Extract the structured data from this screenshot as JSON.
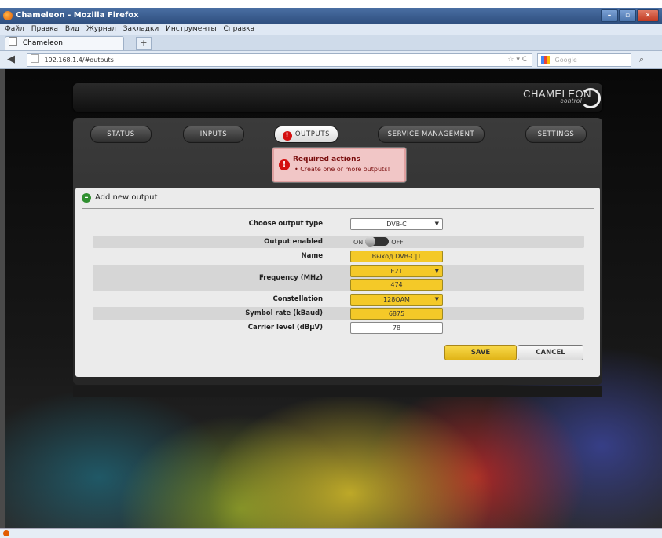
{
  "browser": {
    "window_title": "Chameleon - Mozilla Firefox",
    "menu": [
      "Файл",
      "Правка",
      "Вид",
      "Журнал",
      "Закладки",
      "Инструменты",
      "Справка"
    ],
    "tab_label": "Chameleon",
    "new_tab": "+",
    "url": "192.168.1.4/#outputs",
    "search_placeholder": "Google"
  },
  "header": {
    "logo": "CHAMELEON",
    "logo_sub": "control"
  },
  "tabs": [
    {
      "label": "STATUS"
    },
    {
      "label": "INPUTS"
    },
    {
      "label": "OUTPUTS",
      "alert": "!"
    },
    {
      "label": "SERVICE MANAGEMENT"
    },
    {
      "label": "SETTINGS"
    }
  ],
  "required": {
    "icon": "!",
    "title": "Required actions",
    "message": "• Create one or more outputs!"
  },
  "form": {
    "title": "Add new output",
    "output_type_label": "Choose output type",
    "output_type_value": "DVB-C",
    "output_enabled_label": "Output enabled",
    "toggle_on": "ON",
    "toggle_off": "OFF",
    "name_label": "Name",
    "name_value": "Выход DVB-C|1",
    "frequency_label": "Frequency (MHz)",
    "frequency_channel": "E21",
    "frequency_value": "474",
    "constellation_label": "Constellation",
    "constellation_value": "128QAM",
    "symbol_rate_label": "Symbol rate (kBaud)",
    "symbol_rate_value": "6875",
    "carrier_level_label": "Carrier level (dBµV)",
    "carrier_level_value": "78",
    "save": "SAVE",
    "cancel": "CANCEL"
  },
  "colors": {
    "accent": "#f4c928",
    "alert": "#d41010"
  }
}
